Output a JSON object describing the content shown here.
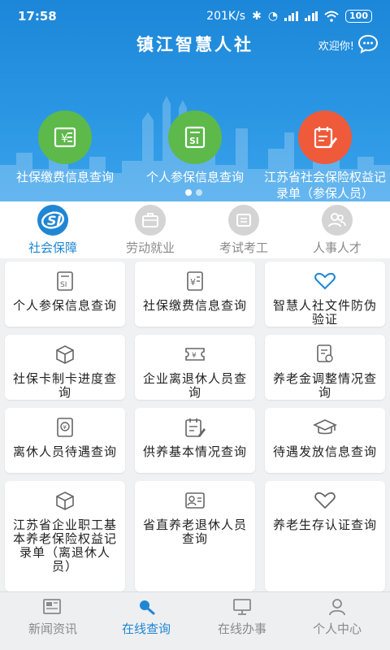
{
  "status": {
    "time": "17:58",
    "net_speed": "201K/s",
    "battery": "100"
  },
  "header": {
    "title": "镇江智慧人社",
    "welcome": "欢迎你!"
  },
  "banner": [
    {
      "label": "社保缴费信息查询",
      "color": "#5db94a"
    },
    {
      "label": "个人参保信息查询",
      "color": "#5db94a"
    },
    {
      "label": "江苏省社会保险权益记录单（参保人员）",
      "color": "#ef5a3a"
    }
  ],
  "categories": [
    {
      "label": "社会保障",
      "icon": "social-insurance-logo-icon"
    },
    {
      "label": "劳动就业",
      "icon": "briefcase-icon"
    },
    {
      "label": "考试考工",
      "icon": "scroll-icon"
    },
    {
      "label": "人事人才",
      "icon": "people-icon"
    }
  ],
  "services": [
    {
      "label": "个人参保信息查询",
      "icon": "si-card-icon"
    },
    {
      "label": "社保缴费信息查询",
      "icon": "yuan-card-icon"
    },
    {
      "label": "智慧人社文件防伪验证",
      "icon": "heart-icon"
    },
    {
      "label": "社保卡制卡进度查询",
      "icon": "box-icon"
    },
    {
      "label": "企业离退休人员查询",
      "icon": "ticket-icon"
    },
    {
      "label": "养老金调整情况查询",
      "icon": "certificate-icon"
    },
    {
      "label": "离休人员待遇查询",
      "icon": "money-receipt-icon"
    },
    {
      "label": "供养基本情况查询",
      "icon": "edit-list-icon"
    },
    {
      "label": "待遇发放信息查询",
      "icon": "graduation-cap-icon"
    },
    {
      "label": "江苏省企业职工基本养老保险权益记录单（离退休人员）",
      "icon": "box-icon"
    },
    {
      "label": "省直养老退休人员查询",
      "icon": "id-card-icon"
    },
    {
      "label": "养老生存认证查询",
      "icon": "heart-icon"
    }
  ],
  "tabs": [
    {
      "label": "新闻资讯",
      "icon": "newspaper-icon"
    },
    {
      "label": "在线查询",
      "icon": "search-icon"
    },
    {
      "label": "在线办事",
      "icon": "monitor-icon"
    },
    {
      "label": "个人中心",
      "icon": "user-icon"
    }
  ],
  "colors": {
    "primary": "#1f86d4",
    "inactive": "#8a8a8a"
  }
}
